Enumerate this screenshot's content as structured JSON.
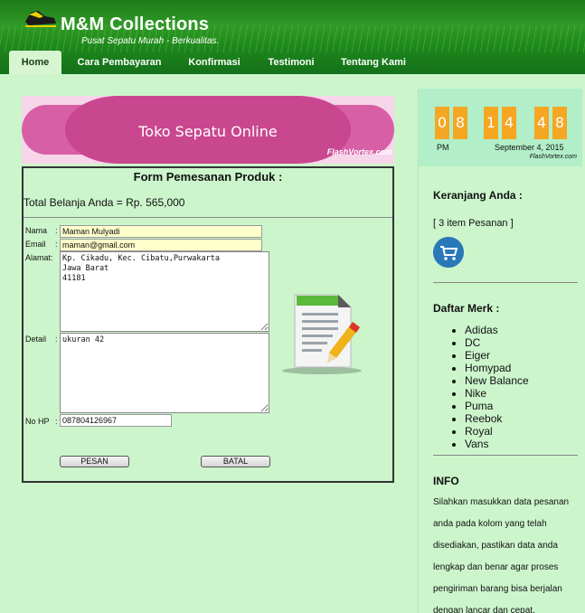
{
  "site": {
    "title": "M&M Collections",
    "tagline": "Pusat Sepatu Murah - Berkualitas."
  },
  "nav": {
    "items": [
      {
        "label": "Home",
        "active": true
      },
      {
        "label": "Cara Pembayaran",
        "active": false
      },
      {
        "label": "Konfirmasi",
        "active": false
      },
      {
        "label": "Testimoni",
        "active": false
      },
      {
        "label": "Tentang Kami",
        "active": false
      }
    ]
  },
  "banner": {
    "text": "Toko Sepatu Online",
    "credit": "FlashVortex.com"
  },
  "form": {
    "title": "Form Pemesanan Produk :",
    "total": "Total Belanja Anda = Rp. 565,000",
    "labels": {
      "nama": "Nama",
      "email": "Email",
      "alamat": "Alamat:",
      "detail": "Detail",
      "nohp": "No HP"
    },
    "colon": ":",
    "values": {
      "nama": "Maman Mulyadi",
      "email": "maman@gmail.com",
      "alamat": "Kp. Cikadu, Kec. Cibatu,Purwakarta\nJawa Barat\n41181",
      "detail": "ukuran 42",
      "nohp": "087804126967"
    },
    "buttons": {
      "submit": "PESAN",
      "cancel": "BATAL"
    }
  },
  "clock": {
    "digits": [
      "0",
      "8",
      "1",
      "4",
      "4",
      "8"
    ],
    "ampm": "PM",
    "date": "September 4, 2015",
    "credit": "FlashVortex.com",
    "color": "#f5a623"
  },
  "sidebar": {
    "cart_heading": "Keranjang Anda :",
    "cart_count": "[ 3 item Pesanan ]",
    "brands_heading": "Daftar Merk :",
    "brands": [
      "Adidas",
      "DC",
      "Eiger",
      "Homypad",
      "New Balance",
      "Nike",
      "Puma",
      "Reebok",
      "Royal",
      "Vans"
    ],
    "info_heading": "INFO",
    "info_text": "Silahkan masukkan data pesanan anda pada kolom yang telah disediakan, pastikan data anda lengkap dan benar agar proses pengiriman barang bisa berjalan dengan lancar dan cepat."
  },
  "icons": {
    "logo": "shoe-icon",
    "document": "document-pencil-icon",
    "cart": "shopping-cart-icon"
  }
}
